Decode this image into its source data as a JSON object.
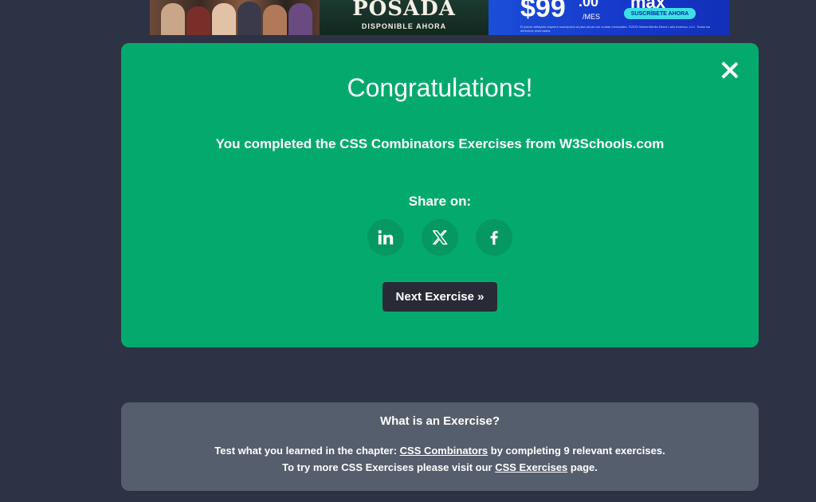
{
  "ad": {
    "title": "POSADA",
    "subtitle": "DISPONIBLE AHORA",
    "price": "$99",
    "price_cents": ".00",
    "price_period": "/MES",
    "brand": "max",
    "cta": "SUSCRÍBETE AHORA",
    "fine_print": "El precio reflejado requiere suscripción al plan anual con cuotas mensuales. ©2025 WarnerMedia Direct Latin America, LLC. Todos los derechos reservados."
  },
  "congrats": {
    "title": "Congratulations!",
    "message": "You completed the CSS Combinators Exercises from W3Schools.com",
    "share_label": "Share on:",
    "share_buttons": [
      {
        "icon": "linkedin-icon"
      },
      {
        "icon": "x-icon"
      },
      {
        "icon": "facebook-icon"
      }
    ],
    "next_button": "Next Exercise »"
  },
  "info": {
    "title": "What is an Exercise?",
    "line1_prefix": "Test what you learned in the chapter: ",
    "line1_link": "CSS Combinators",
    "line1_suffix": " by completing 9 relevant exercises.",
    "line2_prefix": "To try more CSS Exercises please visit our ",
    "line2_link": "CSS Exercises",
    "line2_suffix": " page."
  },
  "colors": {
    "background": "#2d3345",
    "accent_green": "#04aa6d",
    "share_circle": "#059862",
    "button_dark": "#282a35",
    "info_box": "#555e6c"
  }
}
